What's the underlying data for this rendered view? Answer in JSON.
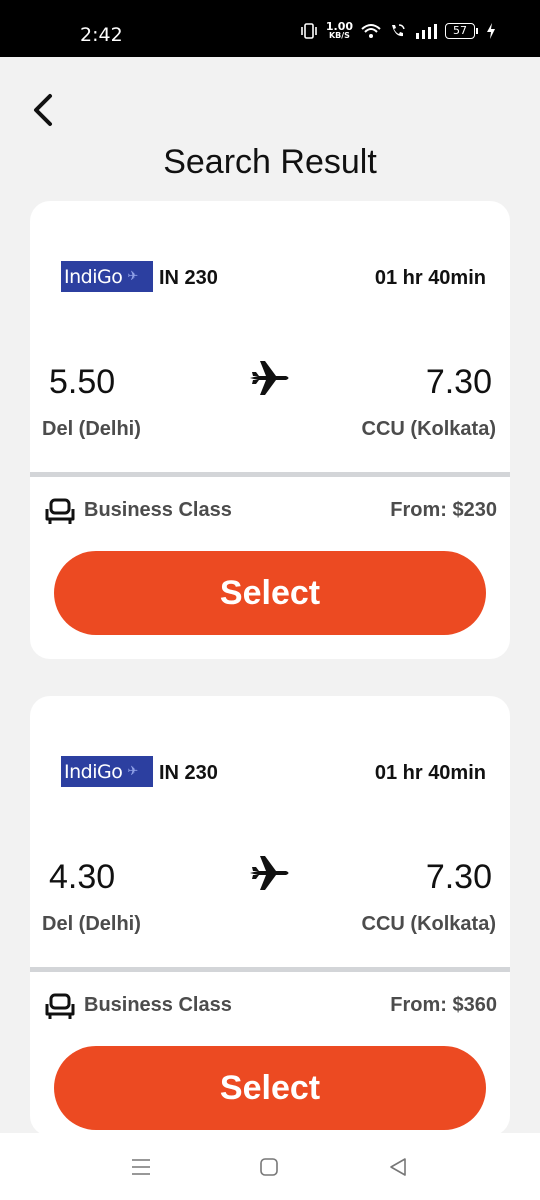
{
  "status_bar": {
    "time": "2:42",
    "net_speed_value": "1.00",
    "net_speed_unit": "KB/S",
    "battery": "57"
  },
  "header": {
    "title": "Search Result"
  },
  "results": [
    {
      "airline_logo_text": "IndiGo",
      "flight_number": "IN 230",
      "duration": "01 hr 40min",
      "departure_time": "5.50",
      "arrival_time": "7.30",
      "departure_city": "Del (Delhi)",
      "arrival_city": "CCU (Kolkata)",
      "class": "Business Class",
      "price": "From: $230",
      "select_label": "Select"
    },
    {
      "airline_logo_text": "IndiGo",
      "flight_number": "IN 230",
      "duration": "01 hr 40min",
      "departure_time": "4.30",
      "arrival_time": "7.30",
      "departure_city": "Del (Delhi)",
      "arrival_city": "CCU (Kolkata)",
      "class": "Business Class",
      "price": "From: $360",
      "select_label": "Select"
    }
  ],
  "colors": {
    "accent": "#ec4a22",
    "logo_bg": "#2c3fa0",
    "background": "#f2f2f2"
  },
  "icons": {
    "back": "chevron-left-icon",
    "plane": "airplane-icon",
    "seat": "seat-icon",
    "nav_menu": "menu-lines-icon",
    "nav_home": "square-home-icon",
    "nav_back": "triangle-back-icon"
  }
}
